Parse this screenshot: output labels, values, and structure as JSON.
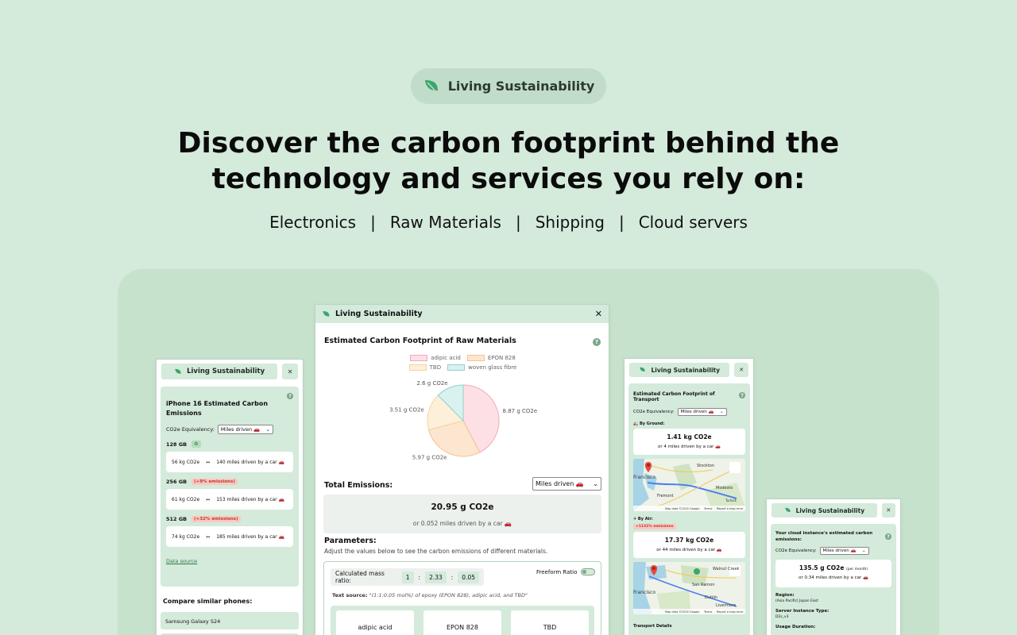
{
  "hero": {
    "brand": "Living Sustainability",
    "headline_1": "Discover the carbon footprint behind the",
    "headline_2": "technology and services you rely on:",
    "nav": [
      "Electronics",
      "Raw Materials",
      "Shipping",
      "Cloud servers"
    ],
    "separator": "|"
  },
  "brand_color": "#3aa76d",
  "left_window": {
    "brand": "Living Sustainability",
    "close": "✕",
    "title": "iPhone 16 Estimated Carbon Emissions",
    "equivalency_label": "CO2e Equivalency:",
    "equivalency_value": "Miles driven 🚗",
    "rows": [
      {
        "size": "128 GB",
        "badge": "♻",
        "co2": "56 kg CO2e",
        "arrow": "↔",
        "miles": "140 miles driven by a car 🚗"
      },
      {
        "size": "256 GB",
        "badge": "(+9% emissions)",
        "co2": "61 kg CO2e",
        "arrow": "↔",
        "miles": "153 miles driven by a car 🚗"
      },
      {
        "size": "512 GB",
        "badge": "(+32% emissions)",
        "co2": "74 kg CO2e",
        "arrow": "↔",
        "miles": "185 miles driven by a car 🚗"
      }
    ],
    "data_source": "Data source",
    "compare_title": "Compare similar phones:",
    "compare_items": [
      "Samsung Galaxy S24"
    ]
  },
  "center_window": {
    "brand": "Living Sustainability",
    "close": "✕",
    "title": "Estimated Carbon Footprint of Raw Materials",
    "help": "?",
    "total_label": "Total Emissions:",
    "total_select": "Miles driven 🚗",
    "total_value": "20.95 g CO2e",
    "total_sub": "or 0.052 miles driven by a car 🚗",
    "params_title": "Parameters:",
    "params_sub": "Adjust the values below to see the carbon emissions of different materials.",
    "ratio_label": "Calculated mass ratio:",
    "ratio_values": [
      "1",
      "2.33",
      "0.05"
    ],
    "ratio_sep": ":",
    "freeform_label": "Freeform Ratio",
    "text_source_label": "Text source:",
    "text_source_value": "\"(1:1:0.05 mol%) of epoxy (EPON 828), adipic acid, and TBD\"",
    "materials": [
      "adipic acid",
      "EPON 828",
      "TBD"
    ]
  },
  "chart_data": {
    "type": "pie",
    "title": "",
    "slices": [
      {
        "label": "adipic acid",
        "value": 8.87,
        "data_label": "8.87 g CO2e",
        "fill": "#fde0e6",
        "stroke": "#f4a7b6"
      },
      {
        "label": "EPON 828",
        "value": 5.97,
        "data_label": "5.97 g CO2e",
        "fill": "#fde6cf",
        "stroke": "#f6c28e"
      },
      {
        "label": "TBD",
        "value": 3.51,
        "data_label": "3.51 g CO2e",
        "fill": "#fdf0da",
        "stroke": "#f3d69a"
      },
      {
        "label": "woven glass fibre",
        "value": 2.6,
        "data_label": "2.6 g CO2e",
        "fill": "#d9f1ef",
        "stroke": "#8dd3cc"
      }
    ],
    "legend": [
      "adipic acid",
      "EPON 828",
      "TBD",
      "woven glass fibre"
    ],
    "legend_position": "top"
  },
  "transport_window": {
    "brand": "Living Sustainability",
    "close": "✕",
    "title": "Estimated Carbon Footprint of Transport",
    "help": "?",
    "equivalency_label": "CO2e Equivalency:",
    "equivalency_value": "Miles driven 🚗",
    "ground_label": "🚛 By Ground:",
    "ground_value": "1.41 kg CO2e",
    "ground_sub": "or 4 miles driven by a car 🚗",
    "air_label": "✈ By Air:",
    "air_badge": "+1131% emissions",
    "air_value": "17.37 kg CO2e",
    "air_sub": "or 44 miles driven by a car 🚗",
    "map_places_1": [
      "Francisco",
      "Stockton",
      "Modesto",
      "Fremont",
      "Turlock"
    ],
    "map_places_2": [
      "Francisco",
      "Walnut Creek",
      "San Ramon",
      "Dublin",
      "Livermore"
    ],
    "map_footer": "Map data ©2025 Google",
    "map_terms": "Terms",
    "map_report": "Report a map error",
    "details": "Transport Details"
  },
  "cloud_window": {
    "brand": "Living Sustainability",
    "close": "✕",
    "title": "Your cloud instance's estimated carbon emissions:",
    "help": "?",
    "equivalency_label": "CO2e Equivalency:",
    "equivalency_value": "Miles driven 🚗",
    "value": "135.5 g CO2e",
    "value_unit": "(per month)",
    "sub": "or 0.34 miles driven by a car 🚗",
    "region_label": "Region:",
    "region_value": "(Asia Pacific) Japan East",
    "server_label": "Server Instance Type:",
    "server_value": "D2s_v3",
    "usage_label": "Usage Duration:"
  }
}
